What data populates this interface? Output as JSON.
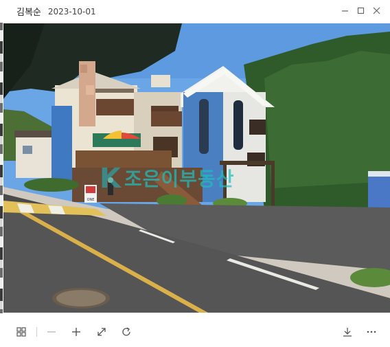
{
  "window": {
    "title": "김복순",
    "date": "2023-10-01"
  },
  "photo": {
    "watermark_brand": "K",
    "watermark_text": "조은이부동산",
    "sign_text": "ONE"
  },
  "toolbar": {
    "icons": [
      "grid-icon",
      "zoom-out-icon",
      "zoom-in-icon",
      "fit-expand-icon",
      "rotate-icon",
      "download-icon",
      "more-icon"
    ]
  },
  "colors": {
    "sky": "#6aa6e6",
    "house_blue": "#4a7fc1",
    "forest": "#2f5a2a",
    "road": "#4a4a4a",
    "watermark": "#1ebebe"
  }
}
